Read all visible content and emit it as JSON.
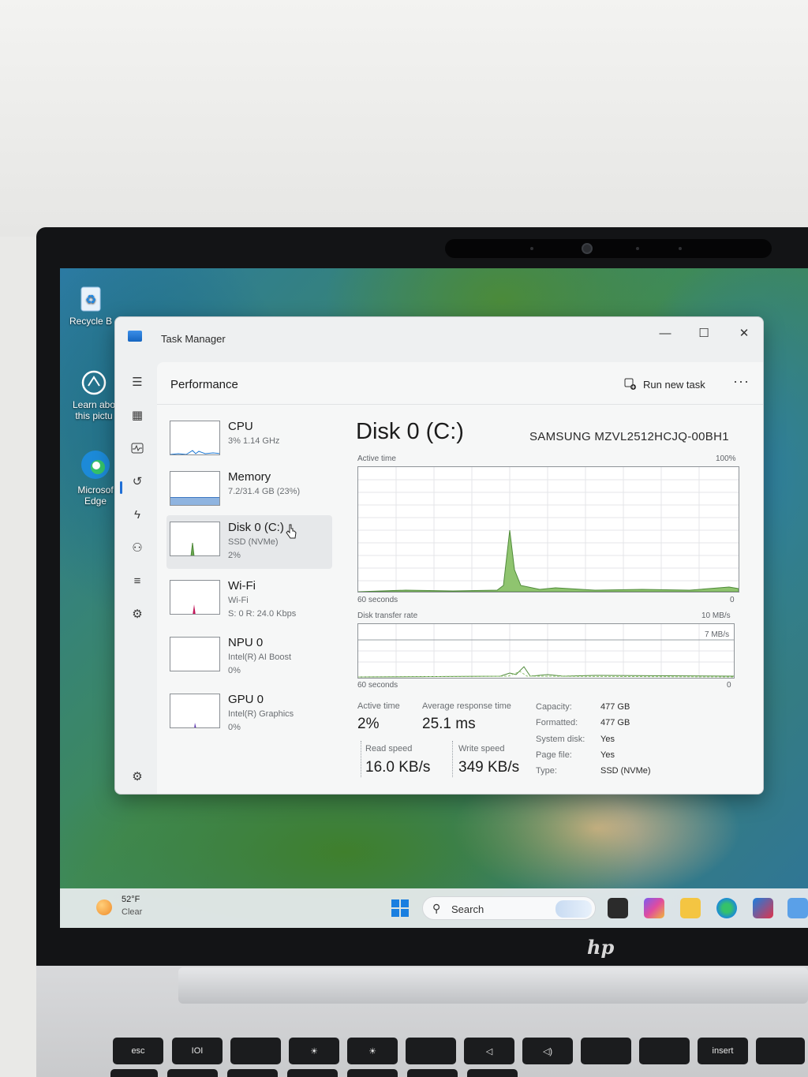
{
  "desktop": {
    "icons": [
      {
        "label": "Recycle Bin",
        "label_visible": "Recycle B"
      },
      {
        "label_line1": "Learn abo",
        "label_line2": "this pictu"
      },
      {
        "label_line1": "Microsof",
        "label_line2": "Edge"
      }
    ]
  },
  "window": {
    "title": "Task Manager",
    "minimize": "—",
    "maximize": "☐",
    "close": "✕"
  },
  "header": {
    "title": "Performance",
    "run_new_task": "Run new task",
    "more": "···"
  },
  "devices": [
    {
      "name": "CPU",
      "line1": "3%  1.14 GHz",
      "line2": ""
    },
    {
      "name": "Memory",
      "line1": "7.2/31.4 GB (23%)",
      "line2": ""
    },
    {
      "name": "Disk 0 (C:)",
      "line1": "SSD (NVMe)",
      "line2": "2%"
    },
    {
      "name": "Wi-Fi",
      "line1": "Wi-Fi",
      "line2": "S: 0  R: 24.0 Kbps"
    },
    {
      "name": "NPU 0",
      "line1": "Intel(R) AI Boost",
      "line2": "0%"
    },
    {
      "name": "GPU 0",
      "line1": "Intel(R) Graphics",
      "line2": "0%"
    }
  ],
  "detail": {
    "title": "Disk 0 (C:)",
    "model": "SAMSUNG MZVL2512HCJQ-00BH1",
    "graph1": {
      "label": "Active time",
      "max": "100%",
      "x_left": "60 seconds",
      "x_right": "0"
    },
    "graph2": {
      "label": "Disk transfer rate",
      "max": "10 MB/s",
      "inner_max": "7 MB/s",
      "x_left": "60 seconds",
      "x_right": "0"
    },
    "stats": {
      "active_time_label": "Active time",
      "active_time_value": "2%",
      "avg_response_label": "Average response time",
      "avg_response_value": "25.1 ms",
      "read_speed_label": "Read speed",
      "read_speed_value": "16.0 KB/s",
      "write_speed_label": "Write speed",
      "write_speed_value": "349 KB/s"
    },
    "properties": [
      {
        "key": "Capacity:",
        "value": "477 GB"
      },
      {
        "key": "Formatted:",
        "value": "477 GB"
      },
      {
        "key": "System disk:",
        "value": "Yes"
      },
      {
        "key": "Page file:",
        "value": "Yes"
      },
      {
        "key": "Type:",
        "value": "SSD (NVMe)"
      }
    ]
  },
  "taskbar": {
    "weather_temp": "52°F",
    "weather_cond": "Clear",
    "search_label": "Search",
    "search_icon": "⚲"
  },
  "laptop": {
    "brand": "hp",
    "keys": [
      "esc",
      "IOI",
      "",
      "☀",
      "☀",
      "",
      "◁",
      "◁)",
      "",
      "",
      "insert",
      ""
    ]
  },
  "colors": {
    "accent": "#1f6fd6",
    "disk_graph": "#6aa84f",
    "wifi_graph": "#c2185b",
    "gpu_graph": "#5e35b1",
    "cpu_graph": "#1976d2"
  }
}
